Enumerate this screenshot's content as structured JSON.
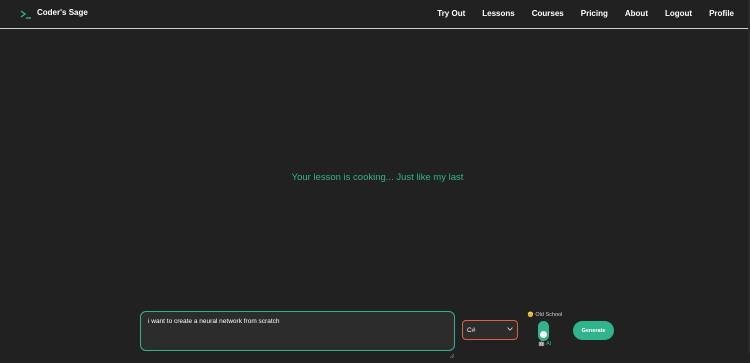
{
  "brand": {
    "name": "Coder's Sage",
    "icon": "terminal-prompt-icon",
    "accent_color": "#2fb48c"
  },
  "nav": {
    "items": [
      {
        "label": "Try Out"
      },
      {
        "label": "Lessons"
      },
      {
        "label": "Courses"
      },
      {
        "label": "Pricing"
      },
      {
        "label": "About"
      },
      {
        "label": "Logout"
      },
      {
        "label": "Profile"
      }
    ]
  },
  "main": {
    "status_text": "Your lesson is cooking... Just like my last"
  },
  "composer": {
    "prompt_value": "i want to create a neural network from scratch",
    "language": {
      "selected": "C#"
    },
    "mode": {
      "top_label": "👴 Old School",
      "bottom_label": "🤖 AI",
      "selected": "AI"
    },
    "generate_label": "Generate"
  },
  "colors": {
    "background": "#212121",
    "accent": "#2fb48c",
    "select_border": "#e0623b"
  }
}
